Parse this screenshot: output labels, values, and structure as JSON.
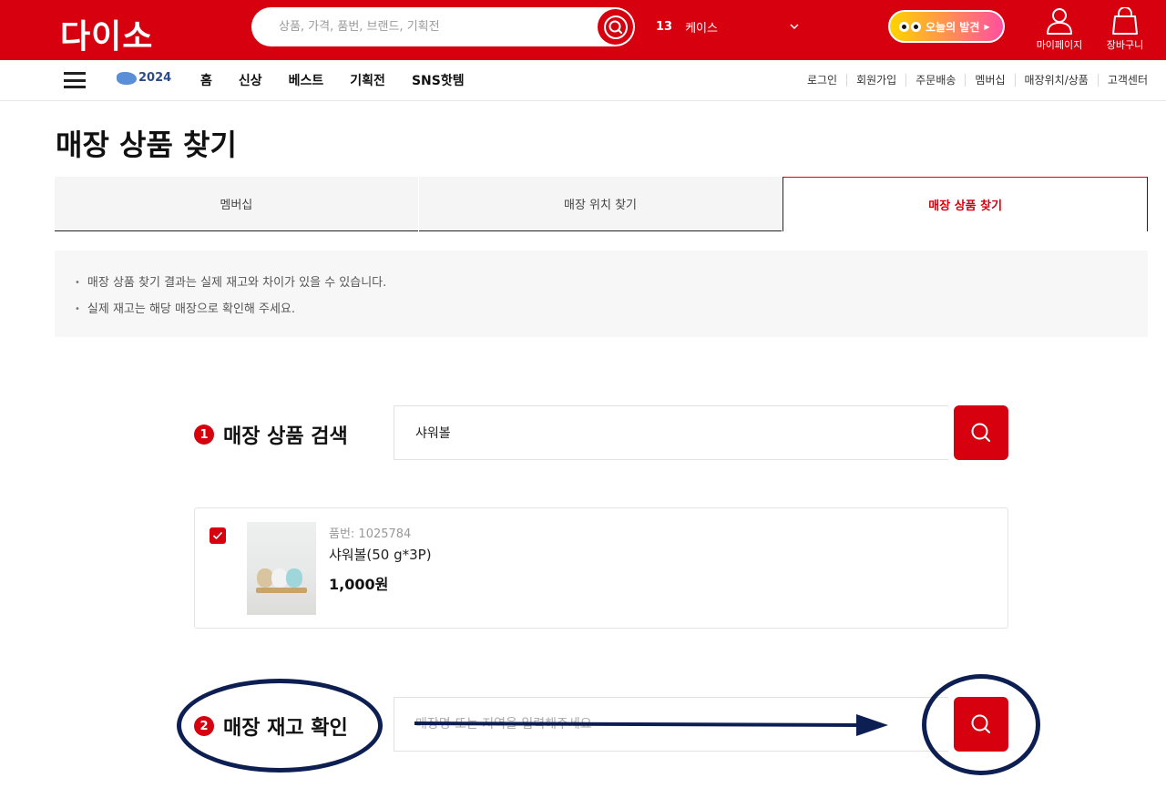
{
  "header": {
    "logo": "다이소",
    "search_placeholder": "상품, 가격, 품번, 브랜드, 기획전",
    "trend_rank": "13",
    "trend_keyword": "케이스",
    "today_label": "오늘의 발견",
    "my_page_label": "마이페이지",
    "cart_label": "장바구니",
    "accent_color": "#d7000f"
  },
  "nav": {
    "year_badge": "2024",
    "main_items": [
      "홈",
      "신상",
      "베스트",
      "기획전",
      "SNS핫템"
    ],
    "util_items": [
      "로그인",
      "회원가입",
      "주문배송",
      "멤버십",
      "매장위치/상품",
      "고객센터"
    ]
  },
  "page": {
    "title": "매장 상품 찾기",
    "tabs": [
      {
        "label": "멤버십",
        "active": false
      },
      {
        "label": "매장 위치 찾기",
        "active": false
      },
      {
        "label": "매장 상품 찾기",
        "active": true
      }
    ],
    "notices": [
      "매장 상품 찾기 결과는 실제 재고와 차이가 있을 수 있습니다.",
      "실제 재고는 해당 매장으로 확인해 주세요."
    ]
  },
  "product_search": {
    "step": "1",
    "label": "매장 상품 검색",
    "value": "샤워볼"
  },
  "product": {
    "checked": true,
    "code": "품번: 1025784",
    "name": "샤워볼(50 g*3P)",
    "price": "1,000원"
  },
  "stock_check": {
    "step": "2",
    "label": "매장 재고 확인",
    "placeholder": "매장명 또는 지역을 입력해주세요"
  },
  "icons": {
    "search": "search-icon",
    "menu": "hamburger-icon",
    "user": "user-icon",
    "cart": "shopping-bag-icon",
    "check": "check-icon",
    "chevron": "chevron-down-icon"
  }
}
